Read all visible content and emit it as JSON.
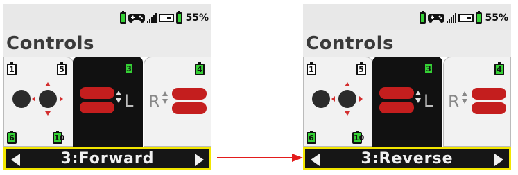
{
  "status": {
    "battery_pct": "55%"
  },
  "title": "Controls",
  "panels": {
    "joystick": {
      "top_left_port": "1",
      "top_right_port": "5",
      "bottom_left_port": "6",
      "bottom_right_port": "10"
    },
    "left_motor": {
      "port": "3",
      "label": "L"
    },
    "right_motor": {
      "port": "4",
      "label": "R"
    }
  },
  "screens": [
    {
      "selection": "3:Forward"
    },
    {
      "selection": "3:Reverse"
    }
  ],
  "colors": {
    "accent_green": "#35d135",
    "motor_red": "#c41e1e",
    "selection_border": "#f2e600",
    "arrow": "#e31b1b"
  }
}
